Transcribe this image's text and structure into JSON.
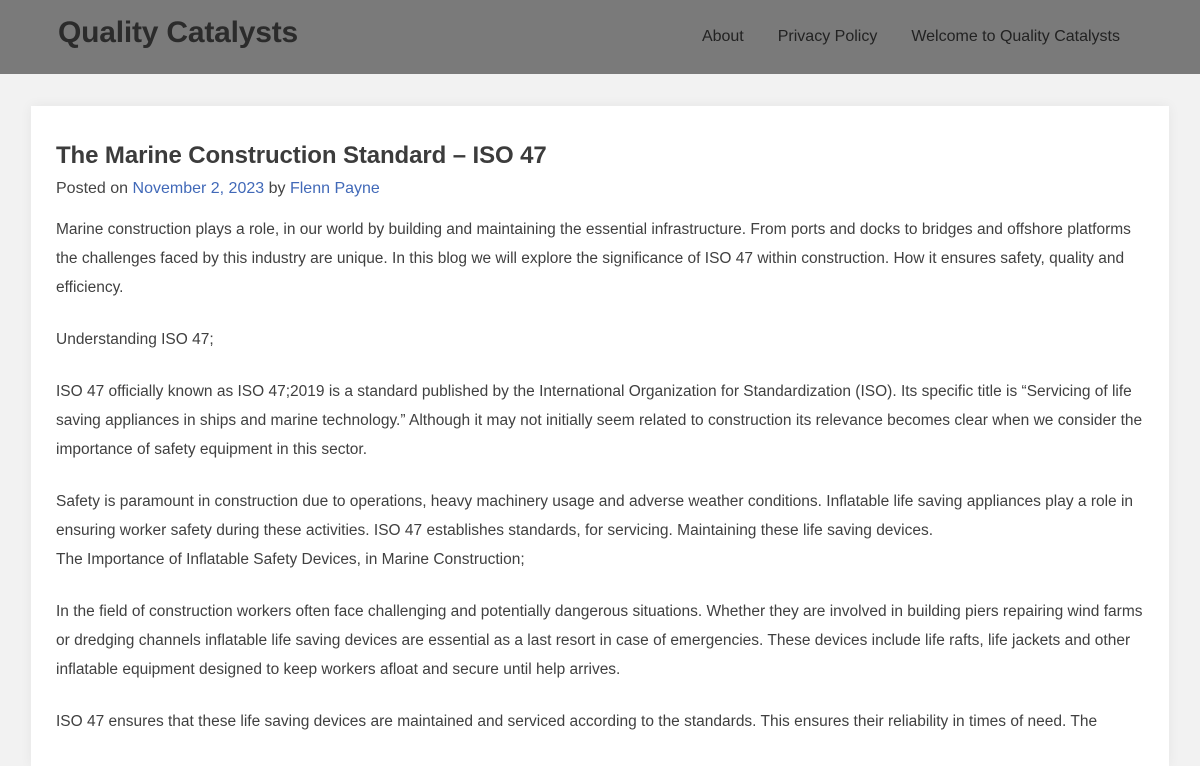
{
  "header": {
    "site_title": "Quality Catalysts",
    "nav": [
      {
        "label": "About"
      },
      {
        "label": "Privacy Policy"
      },
      {
        "label": "Welcome to Quality Catalysts"
      }
    ]
  },
  "post": {
    "title": "The Marine Construction Standard – ISO 47",
    "meta": {
      "posted_on_label": "Posted on",
      "date": "November 2, 2023",
      "by_label": "by",
      "author": "Flenn Payne"
    },
    "paragraphs": [
      "Marine construction plays a role, in our world by building and maintaining the essential infrastructure. From ports and docks to bridges and offshore platforms the challenges faced by this industry are unique. In this blog we will explore the significance of ISO 47 within construction. How it ensures safety, quality and efficiency.",
      "Understanding ISO 47;",
      "ISO 47 officially known as ISO 47;2019 is a standard published by the International Organization for Standardization (ISO). Its specific title is “Servicing of life saving appliances in ships and marine technology.” Although it may not initially seem related to construction its relevance becomes clear when we consider the importance of safety equipment in this sector.",
      "Safety is paramount in construction due to operations, heavy machinery usage and adverse weather conditions. Inflatable life saving appliances play a role in ensuring worker safety during these activities. ISO 47 establishes standards, for servicing. Maintaining these life saving devices.",
      "The Importance of Inflatable Safety Devices, in Marine Construction;",
      "In the field of construction workers often face challenging and potentially dangerous situations. Whether they are involved in building piers repairing wind farms or dredging channels inflatable life saving devices are essential as a last resort in case of emergencies. These devices include life rafts, life jackets and other inflatable equipment designed to keep workers afloat and secure until help arrives.",
      "ISO 47 ensures that these life saving devices are maintained and serviced according to the standards. This ensures their reliability in times of need. The"
    ]
  },
  "colors": {
    "header_bg": "#7a7a7a",
    "page_bg": "#f2f2f2",
    "link": "#4169b8"
  }
}
